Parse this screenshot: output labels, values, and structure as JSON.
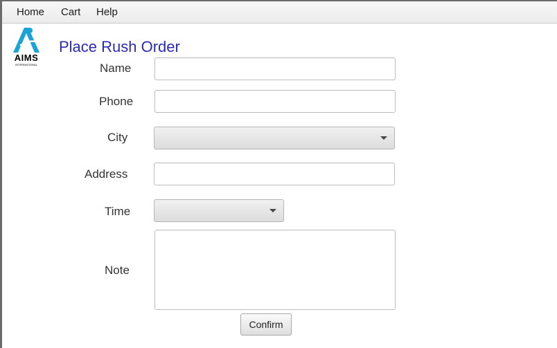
{
  "menubar": {
    "items": [
      {
        "label": "Home"
      },
      {
        "label": "Cart"
      },
      {
        "label": "Help"
      }
    ]
  },
  "logo": {
    "text": "AIMS",
    "subtext": "INTERNATIONAL",
    "color": "#1aa3d6"
  },
  "page": {
    "title": "Place Rush Order",
    "title_color": "#2a2ab6"
  },
  "form": {
    "name": {
      "label": "Name",
      "value": ""
    },
    "phone": {
      "label": "Phone",
      "value": ""
    },
    "city": {
      "label": "City",
      "selected": ""
    },
    "address": {
      "label": "Address",
      "value": ""
    },
    "time": {
      "label": "Time",
      "selected": ""
    },
    "note": {
      "label": "Note",
      "value": ""
    },
    "confirm_label": "Confirm"
  }
}
